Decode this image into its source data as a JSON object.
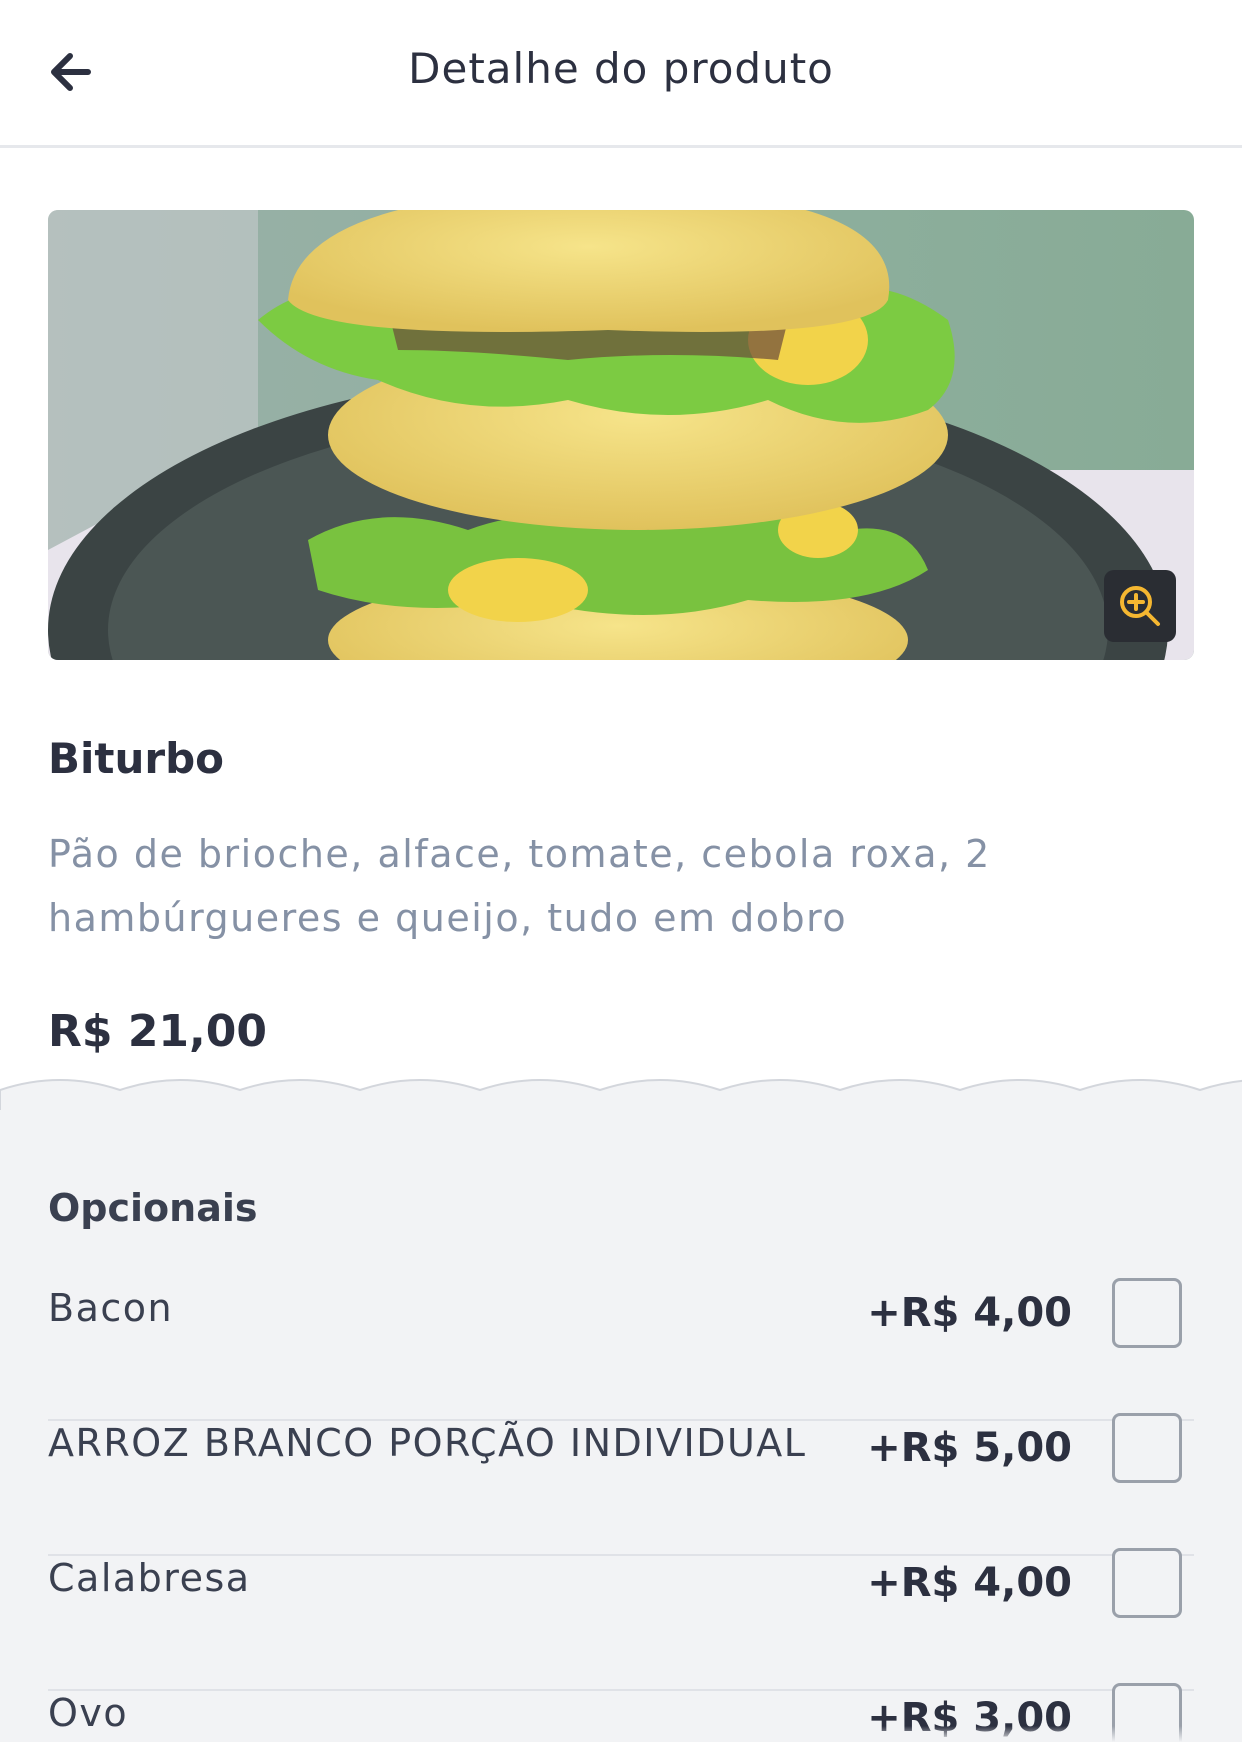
{
  "header": {
    "title": "Detalhe do produto",
    "back_icon": "arrow-left-icon"
  },
  "product": {
    "name": "Biturbo",
    "description": "Pão de brioche, alface, tomate, cebola roxa, 2 hambúrgueres e queijo, tudo em dobro",
    "price": "R$ 21,00",
    "image_alt": "burger",
    "zoom_icon": "zoom-in-icon"
  },
  "options": {
    "title": "Opcionais",
    "items": [
      {
        "name": "Bacon",
        "price": "+R$ 4,00",
        "checked": false
      },
      {
        "name": "ARROZ BRANCO PORÇÃO INDIVIDUAL",
        "price": "+R$ 5,00",
        "checked": false
      },
      {
        "name": "Calabresa",
        "price": "+R$ 4,00",
        "checked": false
      },
      {
        "name": "Ovo",
        "price": "+R$ 3,00",
        "checked": false
      }
    ]
  },
  "colors": {
    "accent": "#f5b731",
    "zoom_bg": "#2a2d33",
    "text_dark": "#2c3040",
    "text_muted": "#8591a5",
    "options_bg": "#f2f3f5"
  }
}
